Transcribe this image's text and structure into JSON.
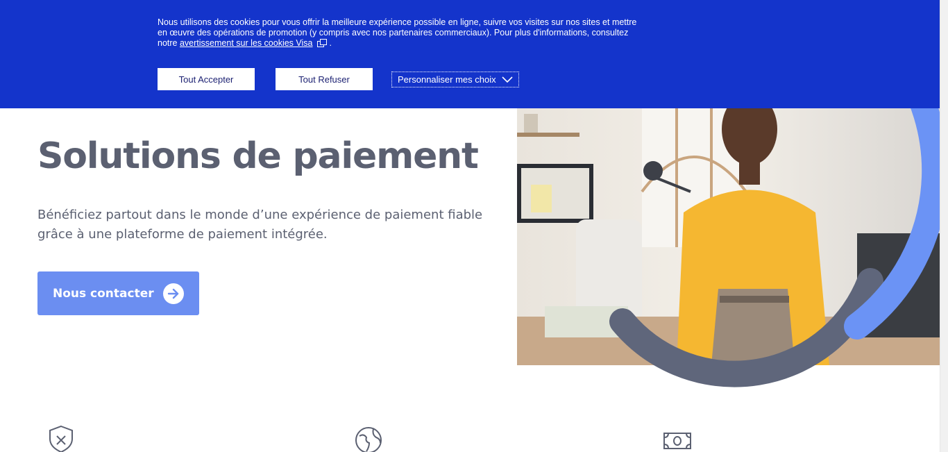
{
  "cookie_banner": {
    "text_main": "Nous utilisons des cookies pour vous offrir la meilleure expérience possible en ligne, suivre vos visites sur nos sites et mettre en œuvre des opérations de promotion (y compris avec nos partenaires commerciaux). Pour plus d'informations, consultez notre",
    "link_text": "avertissement sur les cookies Visa",
    "text_end": ".",
    "accept_label": "Tout Accepter",
    "refuse_label": "Tout Refuser",
    "customize_label": "Personnaliser mes choix"
  },
  "hero": {
    "title": "Solutions de paiement",
    "description": "Bénéficiez partout dans le monde d’une expérience de paiement fiable grâce à une plateforme de paiement intégrée.",
    "cta_label": "Nous contacter"
  },
  "features": {
    "icons": [
      "shield-x-icon",
      "globe-icon",
      "banknote-icon"
    ]
  },
  "colors": {
    "banner_blue": "#1434cb",
    "cta_blue": "#6b8ef1",
    "arc_blue": "#6b93f5",
    "arc_slate": "#5f667b",
    "text_slate": "#5b6071"
  }
}
